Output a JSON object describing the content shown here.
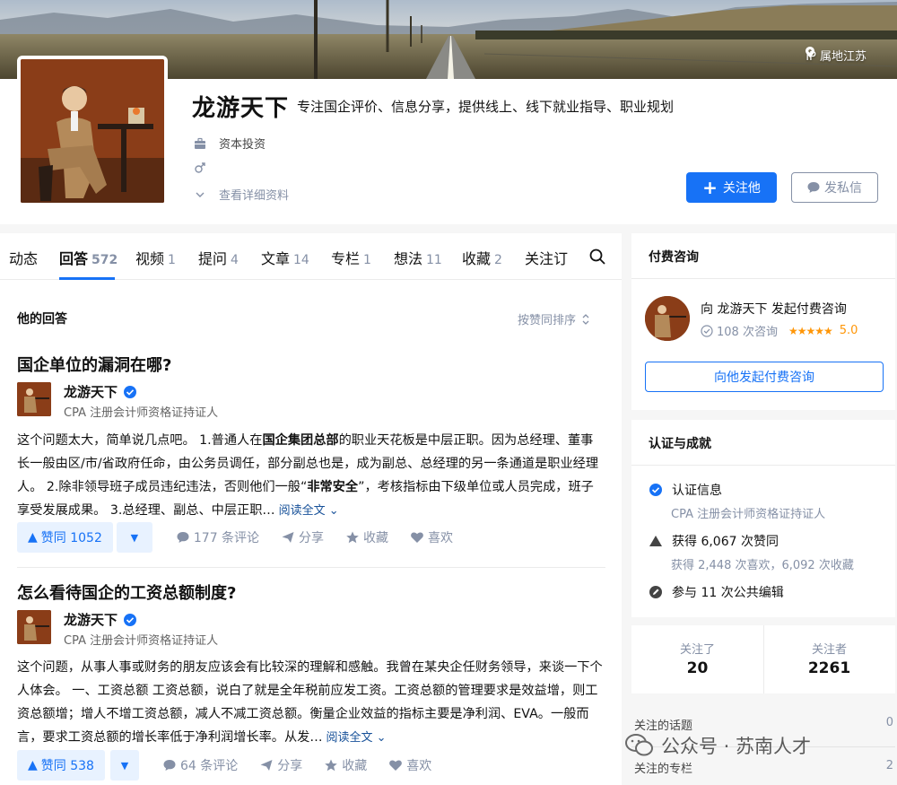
{
  "banner": {
    "ip_label": "IP 属地江苏"
  },
  "profile": {
    "name": "龙游天下",
    "headline": "专注国企评价、信息分享，提供线上、线下就业指导、职业规划",
    "industry": "资本投资",
    "gender_icon": "male-icon",
    "details_link": "查看详细资料",
    "follow_label": "关注他",
    "message_label": "发私信"
  },
  "tabs": [
    {
      "label": "动态",
      "count": ""
    },
    {
      "label": "回答",
      "count": "572"
    },
    {
      "label": "视频",
      "count": "1"
    },
    {
      "label": "提问",
      "count": "4"
    },
    {
      "label": "文章",
      "count": "14"
    },
    {
      "label": "专栏",
      "count": "1"
    },
    {
      "label": "想法",
      "count": "11"
    },
    {
      "label": "收藏",
      "count": "2"
    },
    {
      "label": "关注订",
      "count": ""
    }
  ],
  "answers_section": {
    "title": "他的回答",
    "sort_label": "按赞同排序"
  },
  "answers": [
    {
      "question": "国企单位的漏洞在哪?",
      "author": "龙游天下",
      "author_bio": "CPA 注册会计师资格证持证人",
      "excerpt_1": "这个问题太大，简单说几点吧。 1.普通人在",
      "excerpt_bold_1": "国企集团总部",
      "excerpt_2": "的职业天花板是中层正职。因为总经理、董事长一般由区/市/省政府任命，由公务员调任，部分副总也是，成为副总、总经理的另一条通道是职业经理人。 2.除非领导班子成员违纪违法，否则他们一般“",
      "excerpt_bold_2": "非常安全",
      "excerpt_3": "”，考核指标由下级单位或人员完成，班子享受发展成果。 3.总经理、副总、中层正职…",
      "read_more": "阅读全文",
      "vote_label": "赞同 1052",
      "comments": "177 条评论",
      "share": "分享",
      "collect": "收藏",
      "like": "喜欢"
    },
    {
      "question": "怎么看待国企的工资总额制度?",
      "author": "龙游天下",
      "author_bio": "CPA 注册会计师资格证持证人",
      "excerpt_1": "这个问题，从事人事或财务的朋友应该会有比较深的理解和感触。我曾在某央企任财务领导，来谈一下个人体会。 一、工资总额 工资总额，说白了就是全年税前应发工资。工资总额的管理要求是效益增，则工资总额增；增人不增工资总额，减人不减工资总额。衡量企业效益的指标主要是净利润、EVA。一般而言，要求工资总额的增长率低于净利润增长率。从发…",
      "read_more": "阅读全文",
      "vote_label": "赞同 538",
      "comments": "64 条评论",
      "share": "分享",
      "collect": "收藏",
      "like": "喜欢"
    }
  ],
  "consult": {
    "title": "付费咨询",
    "line": "向 龙游天下 发起付费咨询",
    "count": "108 次咨询",
    "rating": "5.0",
    "button": "向他发起付费咨询"
  },
  "achievements": {
    "title": "认证与成就",
    "verify_label": "认证信息",
    "verify_sub": "CPA 注册会计师资格证持证人",
    "upvotes": "获得 6,067 次赞同",
    "upvotes_sub": "获得 2,448 次喜欢，6,092 次收藏",
    "edits": "参与 11 次公共编辑"
  },
  "follow_stats": {
    "following_label": "关注了",
    "following": "20",
    "followers_label": "关注者",
    "followers": "2261"
  },
  "lists": [
    {
      "label": "关注的话题",
      "count": "0"
    },
    {
      "label": "关注的专栏",
      "count": "2"
    }
  ],
  "watermark": "公众号 · 苏南人才",
  "colors": {
    "accent": "#1772f6",
    "vote_bg": "#e8f2ff",
    "star": "#ff9607",
    "link": "#175199"
  }
}
